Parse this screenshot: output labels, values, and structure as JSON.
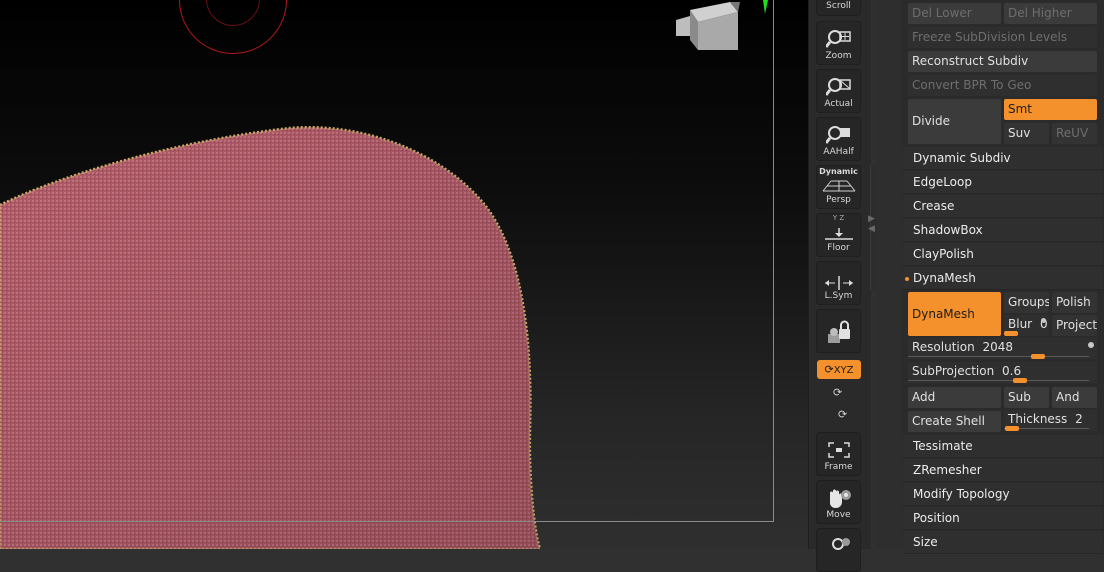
{
  "shelf": {
    "scroll": "Scroll",
    "zoom": "Zoom",
    "actual": "Actual",
    "aahalf": "AAHalf",
    "dynamic": "Dynamic",
    "persp": "Persp",
    "floor": "Floor",
    "floor_axes": "Y Z",
    "lsym": "L.Sym",
    "xyz": "XYZ",
    "frame": "Frame",
    "move": "Move"
  },
  "geometry": {
    "del_lower": "Del Lower",
    "del_higher": "Del Higher",
    "freeze_subdiv": "Freeze SubDivision Levels",
    "reconstruct_subdiv": "Reconstruct Subdiv",
    "convert_bpr": "Convert BPR To Geo",
    "divide": "Divide",
    "smt": "Smt",
    "suv": "Suv",
    "reuv": "ReUV",
    "dynamic_subdiv": "Dynamic Subdiv",
    "edgeloop": "EdgeLoop",
    "crease": "Crease",
    "shadowbox": "ShadowBox",
    "claypolish": "ClayPolish"
  },
  "dynamesh": {
    "header": "DynaMesh",
    "button": "DynaMesh",
    "groups": "Groups",
    "polish": "Polish",
    "blur_label": "Blur",
    "blur_value": "0",
    "project": "Project",
    "resolution_label": "Resolution",
    "resolution_value": "2048",
    "subprojection_label": "SubProjection",
    "subprojection_value": "0.6",
    "add": "Add",
    "sub": "Sub",
    "and": "And",
    "create_shell": "Create Shell",
    "thickness_label": "Thickness",
    "thickness_value": "2"
  },
  "sections": {
    "tessimate": "Tessimate",
    "zremesher": "ZRemesher",
    "modify_topology": "Modify Topology",
    "position": "Position",
    "size": "Size"
  },
  "colors": {
    "accent": "#f4912c",
    "mesh": "#b8606c",
    "mesh_edge": "#c9a86a",
    "panel": "#2b2b2b",
    "button": "#3b3b3b"
  }
}
